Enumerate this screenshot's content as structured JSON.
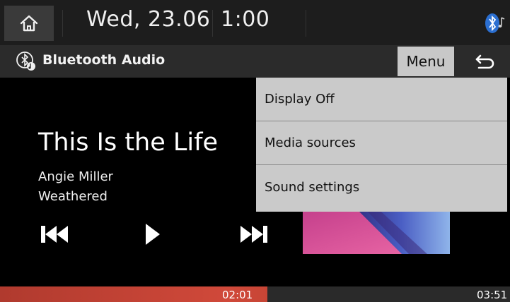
{
  "status_bar": {
    "date": "Wed, 23.06",
    "time": "1:00",
    "icons": {
      "home": "home-icon",
      "bluetooth_audio": "bluetooth-audio-status-icon"
    }
  },
  "title_bar": {
    "title": "Bluetooth Audio",
    "menu_label": "Menu",
    "icons": {
      "source": "bluetooth-audio-icon",
      "back": "back-icon"
    }
  },
  "now_playing": {
    "title": "This Is the Life",
    "artist": "Angie Miller",
    "album": "Weathered",
    "icons": {
      "prev": "skip-previous-icon",
      "play": "play-icon",
      "next": "skip-next-icon"
    }
  },
  "dropdown": {
    "items": [
      {
        "label": "Display Off"
      },
      {
        "label": "Media sources"
      },
      {
        "label": "Sound settings"
      }
    ]
  },
  "progress": {
    "elapsed": "02:01",
    "total": "03:51",
    "fraction": 0.524
  },
  "colors": {
    "accent": "#c94434",
    "menu_bg": "#cacaca",
    "status_bar_bg": "#1d1d1d",
    "title_bar_bg": "#2b2b2b"
  }
}
